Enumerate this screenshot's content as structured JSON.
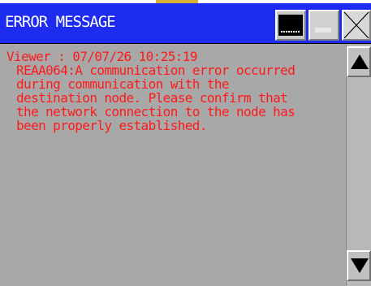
{
  "window": {
    "title": "ERROR MESSAGE",
    "title_bar_color": "#1e2bf0",
    "text_color": "#ff1a1a"
  },
  "titlebar_buttons": {
    "minimize_icon": "minimize-icon",
    "restore_icon": "restore-icon",
    "close_icon": "close-icon"
  },
  "message": {
    "header": "Viewer : 07/07/26 10:25:19",
    "lines": [
      "REAA064:A communication error occurred",
      "during communication with the",
      "destination node. Please confirm that",
      "the network connection to the node has",
      "been properly established."
    ]
  },
  "scrollbar": {
    "up_icon": "arrow-up-icon",
    "down_icon": "arrow-down-icon"
  }
}
